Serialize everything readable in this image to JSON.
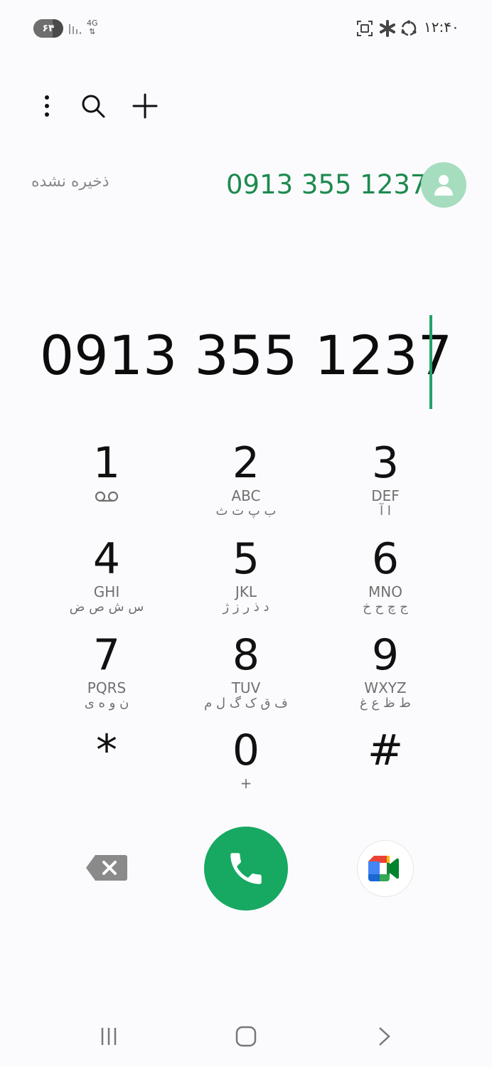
{
  "status_bar": {
    "battery": "۶۴",
    "battery_level": 0.64,
    "network": "4G",
    "time": "۱۲:۴۰",
    "icons": [
      "screenshot-icon",
      "asterisk-icon",
      "sync-icon"
    ]
  },
  "toolbar": {
    "icons": [
      "more-vert-icon",
      "search-icon",
      "add-icon"
    ]
  },
  "match": {
    "label": "ذخیره نشده",
    "number": "0913 355 1237"
  },
  "dialed_number": "0913 355 1237",
  "keypad": [
    {
      "digit": "1",
      "latin": "",
      "persian": "",
      "voicemail": true
    },
    {
      "digit": "2",
      "latin": "ABC",
      "persian": "ب پ ت ث"
    },
    {
      "digit": "3",
      "latin": "DEF",
      "persian": "ا آ"
    },
    {
      "digit": "4",
      "latin": "GHI",
      "persian": "س ش ص ض"
    },
    {
      "digit": "5",
      "latin": "JKL",
      "persian": "د ذ ر ز ژ"
    },
    {
      "digit": "6",
      "latin": "MNO",
      "persian": "ج چ ح خ"
    },
    {
      "digit": "7",
      "latin": "PQRS",
      "persian": "ن و ه ی"
    },
    {
      "digit": "8",
      "latin": "TUV",
      "persian": "ف ق ک گ ل م"
    },
    {
      "digit": "9",
      "latin": "WXYZ",
      "persian": "ط ظ ع غ"
    },
    {
      "digit": "*",
      "latin": "",
      "persian": ""
    },
    {
      "digit": "0",
      "latin": "+",
      "persian": ""
    },
    {
      "digit": "#",
      "latin": "",
      "persian": ""
    }
  ],
  "colors": {
    "accent": "#1d8a4f",
    "call_button": "#17a862",
    "avatar_bg": "#a6ddbf"
  }
}
